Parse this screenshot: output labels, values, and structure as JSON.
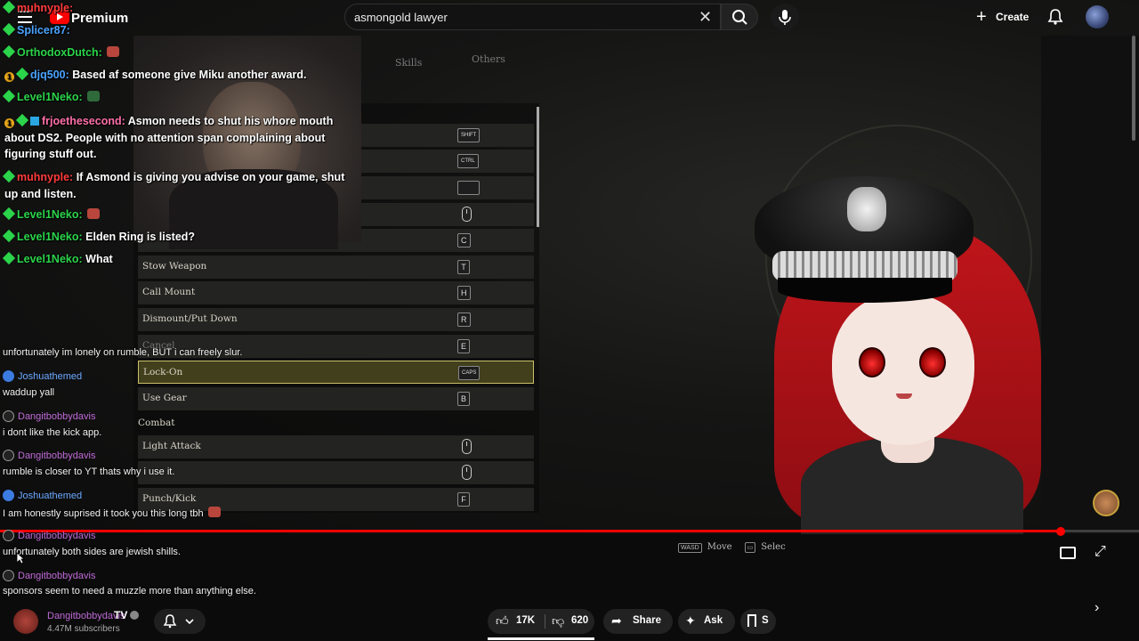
{
  "topbar": {
    "brand": "Premium",
    "search_value": "asmongold lawyer",
    "create_label": "Create"
  },
  "game_menu": {
    "tabs": [
      "Skills",
      "Others"
    ],
    "rows": [
      {
        "label": "",
        "key": "SHIFT"
      },
      {
        "label": "",
        "key": "CTRL"
      },
      {
        "label": "",
        "key": "SPACE"
      },
      {
        "label": "",
        "key": "mouse"
      },
      {
        "label": "",
        "key": "C"
      },
      {
        "label": "Stow Weapon",
        "key": "T"
      },
      {
        "label": "Call Mount",
        "key": "H"
      },
      {
        "label": "Dismount/Put Down",
        "key": "R"
      },
      {
        "label": "Cancel",
        "key": "E"
      },
      {
        "label": "Lock-On",
        "key": "CAPS"
      },
      {
        "label": "Use Gear",
        "key": "B"
      }
    ],
    "section_combat": "Combat",
    "combat_rows": [
      {
        "label": "Light Attack",
        "key": "mouse"
      },
      {
        "label": "",
        "key": "mouse"
      },
      {
        "label": "Punch/Kick",
        "key": "F"
      }
    ],
    "hints": {
      "move_key": "WASD",
      "move": "Move",
      "select": "Selec"
    }
  },
  "chat_top": [
    {
      "user": "muhnyple:",
      "color": "#ff3b3b",
      "text": ""
    },
    {
      "user": "Splicer87:",
      "color": "#4aa3ff",
      "text": ""
    },
    {
      "user": "OrthodoxDutch:",
      "color": "#2bd44a",
      "text": ""
    },
    {
      "user": "djq500:",
      "color": "#4aa3ff",
      "text": "Based af someone give Miku another award."
    },
    {
      "user": "Level1Neko:",
      "color": "#2bd44a",
      "text": ""
    }
  ],
  "chat_block": {
    "user": "frjoethesecond:",
    "color": "#ff6fa8",
    "text": "Asmon needs to shut his whore mouth about DS2. People with no attention span complaining about figuring stuff out."
  },
  "chat_block2": {
    "user": "muhnyple:",
    "color": "#ff3b3b",
    "text": "If Asmond is giving you advise on your game, shut up and listen."
  },
  "chat_tail": [
    {
      "user": "Level1Neko:",
      "color": "#2bd44a",
      "text": ""
    },
    {
      "user": "Level1Neko:",
      "color": "#2bd44a",
      "text": "Elden Ring is listed?"
    },
    {
      "user": "Level1Neko:",
      "color": "#2bd44a",
      "text": "What"
    }
  ],
  "rumble_chat": [
    {
      "user": "",
      "msg": "unfortunately im lonely on rumble, BUT i can freely slur."
    },
    {
      "user": "Joshuathemed",
      "color": "#6aa8ff",
      "msg": "waddup yall"
    },
    {
      "user": "Dangitbobbydavis",
      "color": "#c06ad8",
      "msg": "i dont like the kick app."
    },
    {
      "user": "Dangitbobbydavis",
      "color": "#c06ad8",
      "msg": "rumble is closer to YT thats why i use it."
    },
    {
      "user": "Joshuathemed",
      "color": "#6aa8ff",
      "msg": "I am honestly suprised it took you this long tbh"
    },
    {
      "user": "Dangitbobbydavis",
      "color": "#c06ad8",
      "msg": "unfortunately both sides are jewish shills."
    },
    {
      "user": "Dangitbobbydavis",
      "color": "#c06ad8",
      "msg": "sponsors seem to need a muzzle more than anything else."
    },
    {
      "user": "Dangitbobbydavis",
      "color": "#c06ad8",
      "msg": ""
    }
  ],
  "channel": {
    "name": "TV",
    "subscribers": "4.47M subscribers"
  },
  "actions": {
    "likes": "17K",
    "dislikes": "620",
    "share": "Share",
    "ask": "Ask",
    "save": "S"
  },
  "progress": 0.931,
  "colors": {
    "accent": "#ff0000",
    "selected": "#c9c06a"
  }
}
